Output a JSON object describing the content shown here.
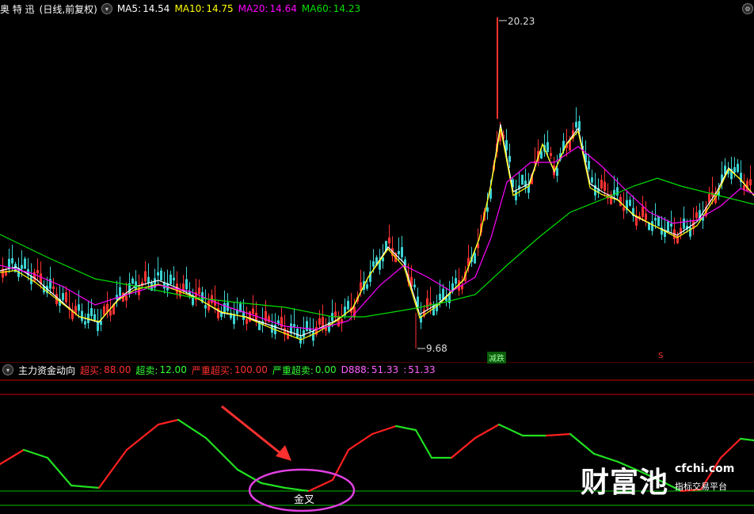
{
  "main": {
    "stock_name": "奥 特 迅",
    "period": "(日线,前复权)",
    "dropdown_icon": "chevron-down-icon",
    "settings_icon": "gear-icon",
    "ma": [
      {
        "label": "MA5:",
        "value": "14.54",
        "color": "#ffffff"
      },
      {
        "label": "MA10:",
        "value": "14.75",
        "color": "#ffff00"
      },
      {
        "label": "MA20:",
        "value": "14.64",
        "color": "#ff00ff"
      },
      {
        "label": "MA60:",
        "value": "14.23",
        "color": "#00e000"
      }
    ],
    "high_label": "20.23",
    "low_label": "9.68",
    "signal_sell": "减跌",
    "signal_s": "S"
  },
  "indicator": {
    "name": "主力资金动向",
    "chevron_icon": "chevron-down-icon",
    "params": [
      {
        "label": "超买:",
        "value": "88.00",
        "color": "#ff3030"
      },
      {
        "label": "超卖:",
        "value": "12.00",
        "color": "#30ff30"
      },
      {
        "label": "严重超买:",
        "value": "100.00",
        "color": "#ff3030"
      },
      {
        "label": "严重超卖:",
        "value": "0.00",
        "color": "#30ff30"
      },
      {
        "label": "D888:",
        "value": "51.33",
        "color": "#ff60ff"
      },
      {
        "label": ":",
        "value": "51.33",
        "color": "#ff60ff"
      }
    ],
    "annotation": "金叉",
    "watermark_main": "财富池",
    "watermark_domain": "cfchi.com",
    "watermark_sub": "指标交易平台"
  },
  "colors": {
    "up": "#ff3232",
    "down": "#3cd2d2",
    "ma5": "#ffffff",
    "ma10": "#ffff00",
    "ma20": "#ff00ff",
    "ma60": "#00e000"
  }
}
